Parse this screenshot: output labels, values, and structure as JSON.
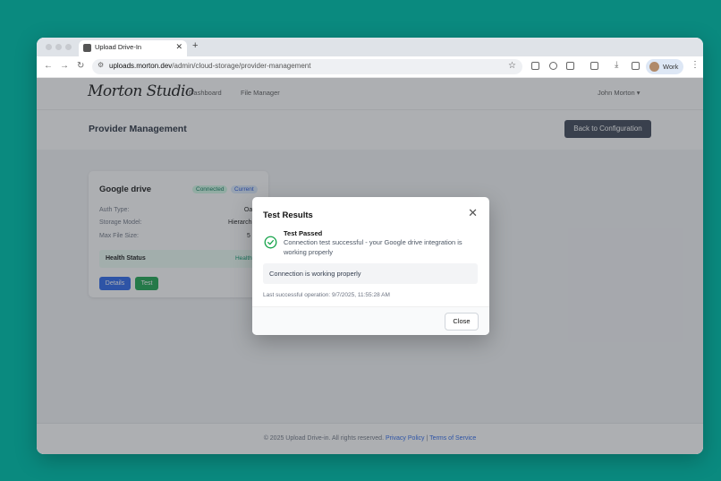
{
  "browser": {
    "tab_title": "Upload Drive-In",
    "url_host": "uploads.morton.dev",
    "url_path": "/admin/cloud-storage/provider-management",
    "profile_label": "Work"
  },
  "app": {
    "logo": "Morton Studio",
    "nav": [
      "Dashboard",
      "File Manager"
    ],
    "user": "John Morton ▾"
  },
  "header": {
    "title": "Provider Management",
    "back_button": "Back to Configuration"
  },
  "card": {
    "title": "Google drive",
    "badge_connected": "Connected",
    "badge_current": "Current",
    "rows": [
      {
        "label": "Auth Type:",
        "value": "Oauth"
      },
      {
        "label": "Storage Model:",
        "value": "Hierarchical"
      },
      {
        "label": "Max File Size:",
        "value": "5 GB"
      }
    ],
    "health_label": "Health Status",
    "health_value": "Healthy",
    "details_button": "Details",
    "test_button": "Test"
  },
  "footer": {
    "copyright": "© 2025 Upload Drive-in. All rights reserved.",
    "privacy": "Privacy Policy",
    "separator": "|",
    "terms": "Terms of Service"
  },
  "modal": {
    "title": "Test Results",
    "status": "Test Passed",
    "message": "Connection test successful - your Google drive integration is working properly",
    "box_text": "Connection is working properly",
    "last_op": "Last successful operation: 9/7/2025, 11:55:28 AM",
    "close_button": "Close"
  },
  "colors": {
    "desktop": "#0a8a7f",
    "success": "#16a34a",
    "primary": "#2563eb"
  }
}
